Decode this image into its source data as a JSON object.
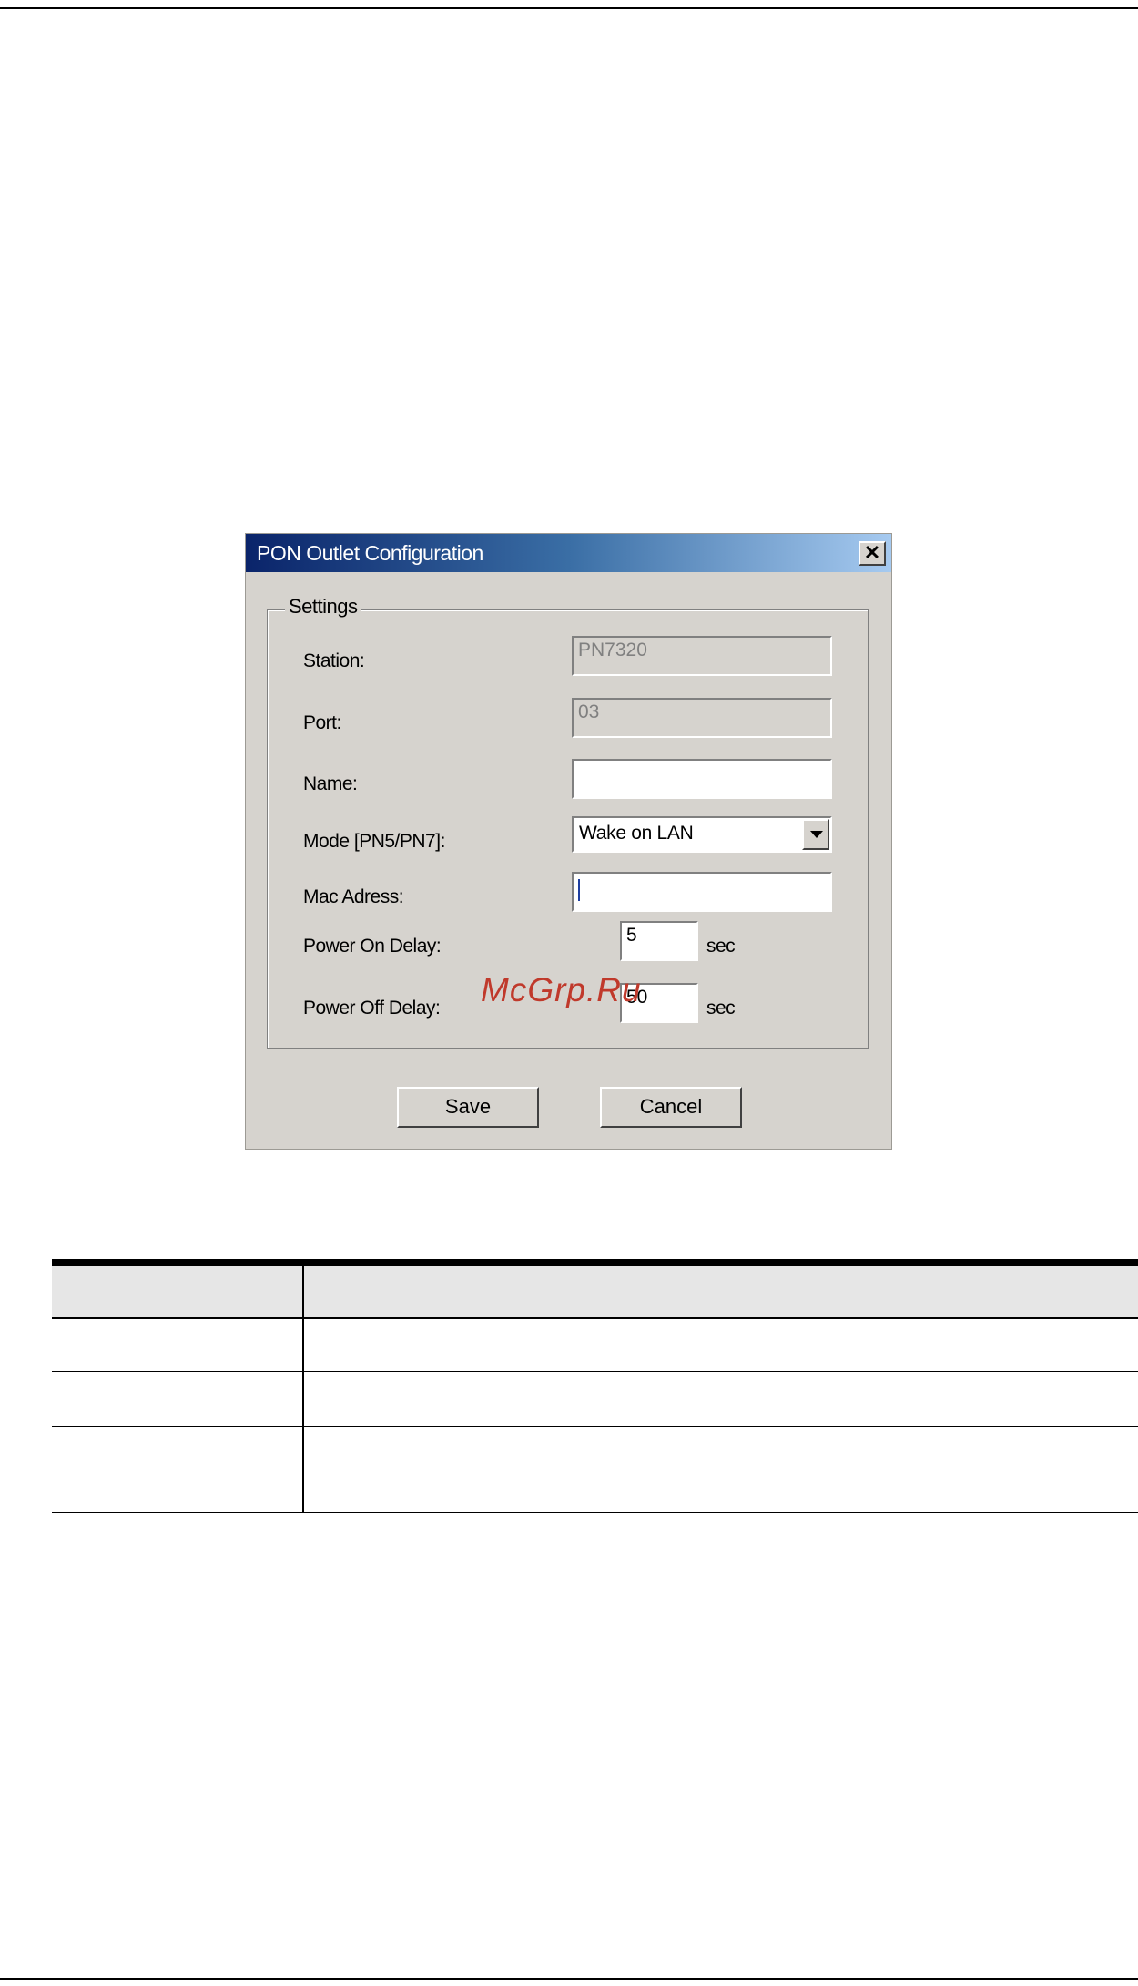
{
  "dialog": {
    "title": "PON Outlet Configuration",
    "close_glyph": "✕",
    "group_label": "Settings",
    "fields": {
      "station": {
        "label": "Station:",
        "value": "PN7320"
      },
      "port": {
        "label": "Port:",
        "value": "03"
      },
      "name": {
        "label": "Name:",
        "value": ""
      },
      "mode": {
        "label": "Mode [PN5/PN7]:",
        "value": "Wake on LAN"
      },
      "mac": {
        "label": "Mac Adress:",
        "value": ""
      },
      "power_on_delay": {
        "label": "Power On Delay:",
        "value": "5",
        "unit": "sec"
      },
      "power_off_delay": {
        "label": "Power Off Delay:",
        "value": "50",
        "unit": "sec"
      }
    },
    "buttons": {
      "save": "Save",
      "cancel": "Cancel"
    }
  },
  "watermark": "McGrp.Ru",
  "table": {
    "header": [
      "",
      ""
    ],
    "rows": [
      [
        "",
        ""
      ],
      [
        "",
        ""
      ],
      [
        "",
        ""
      ]
    ]
  }
}
